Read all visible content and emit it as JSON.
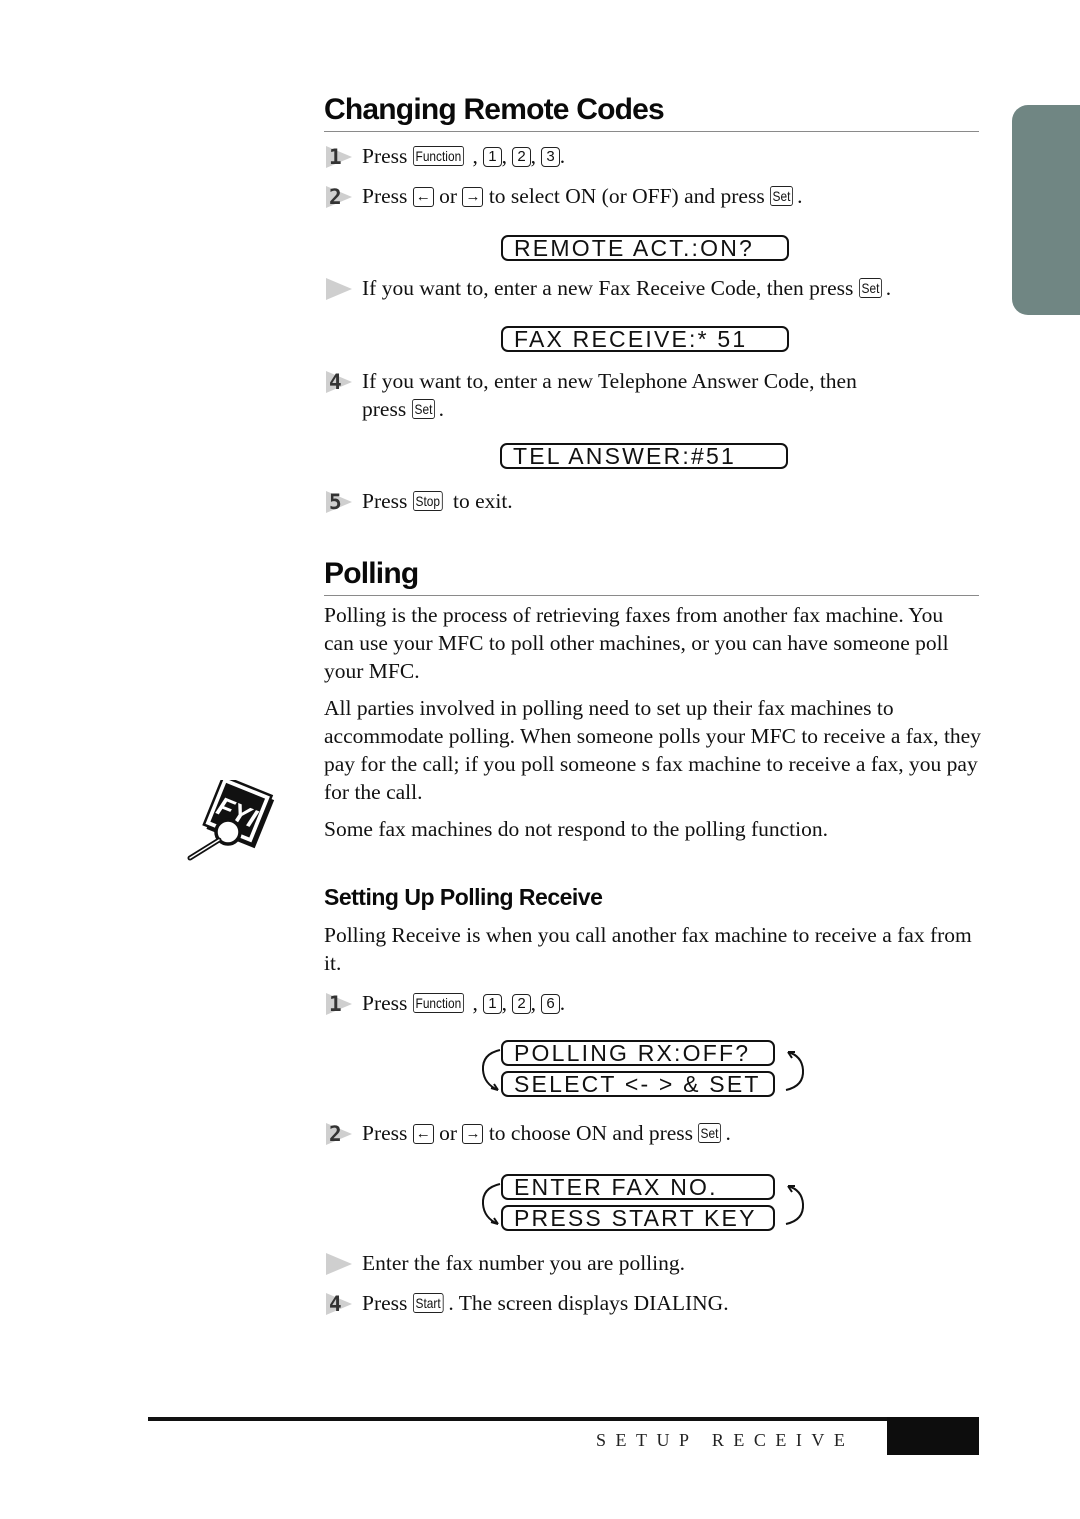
{
  "sections": {
    "remote_codes": {
      "title": "Changing Remote Codes",
      "steps": [
        {
          "marker": "1",
          "prefix": "Press",
          "keys": [
            "Function",
            "1",
            "2",
            "3"
          ],
          "suffix": "."
        },
        {
          "marker": "2",
          "text_a": "Press",
          "key_left": "←",
          "text_b": "or",
          "key_right": "→",
          "text_c": "to select ON (or OFF) and press",
          "key_set": "Set",
          "text_d": "."
        },
        {
          "marker": "",
          "text_a": "If you want to, enter a new Fax Receive Code, then press",
          "key_set": "Set",
          "text_b": "."
        },
        {
          "marker": "4",
          "text_a": "If you want to, enter a new Telephone Answer Code, then",
          "text_b": "press",
          "key_set": "Set",
          "text_c": "."
        },
        {
          "marker": "5",
          "text_a": "Press",
          "key_stop": "Stop",
          "text_b": "to exit."
        }
      ],
      "displays": [
        "REMOTE ACT.:ON?",
        "FAX RECEIVE:* 51",
        "TEL ANSWER:#51"
      ]
    },
    "polling": {
      "title": "Polling",
      "paragraphs": [
        "Polling is the process of retrieving faxes from another fax machine.  You can use your MFC to  poll  other machines, or you can have someone poll your MFC.",
        "All parties involved in polling need to set up their fax machines to accommodate polling.  When someone polls your MFC to receive a fax, they pay for the call; if you poll someone s fax machine to receive a fax, you pay for the call.",
        "Some fax machines do not respond to the polling function."
      ],
      "fyi_icon": "FYI"
    },
    "polling_receive": {
      "title": "Setting Up Polling Receive",
      "intro": "Polling Receive is when you call another fax machine to receive a fax from it.",
      "steps": [
        {
          "marker": "1",
          "prefix": "Press",
          "keys": [
            "Function",
            "1",
            "2",
            "6"
          ],
          "suffix": "."
        },
        {
          "marker": "2",
          "text_a": "Press",
          "key_left": "←",
          "text_b": "or",
          "key_right": "→",
          "text_c": "to choose ON and press",
          "key_set": "Set",
          "text_d": "."
        },
        {
          "marker": "",
          "text_a": "Enter the fax number you are polling."
        },
        {
          "marker": "4",
          "text_a": "Press",
          "key_start": "Start",
          "text_b": ". The screen displays DIALING."
        }
      ],
      "displays": [
        {
          "line1": "POLLING RX:OFF?",
          "line2": "SELECT <- > & SET"
        },
        {
          "line1": "ENTER FAX NO.",
          "line2": "PRESS START KEY"
        }
      ]
    }
  },
  "footer": {
    "chapter": "SETUP RECEIVE"
  },
  "colors": {
    "side_tab": "#708683",
    "marker": "#cfcfcf"
  }
}
